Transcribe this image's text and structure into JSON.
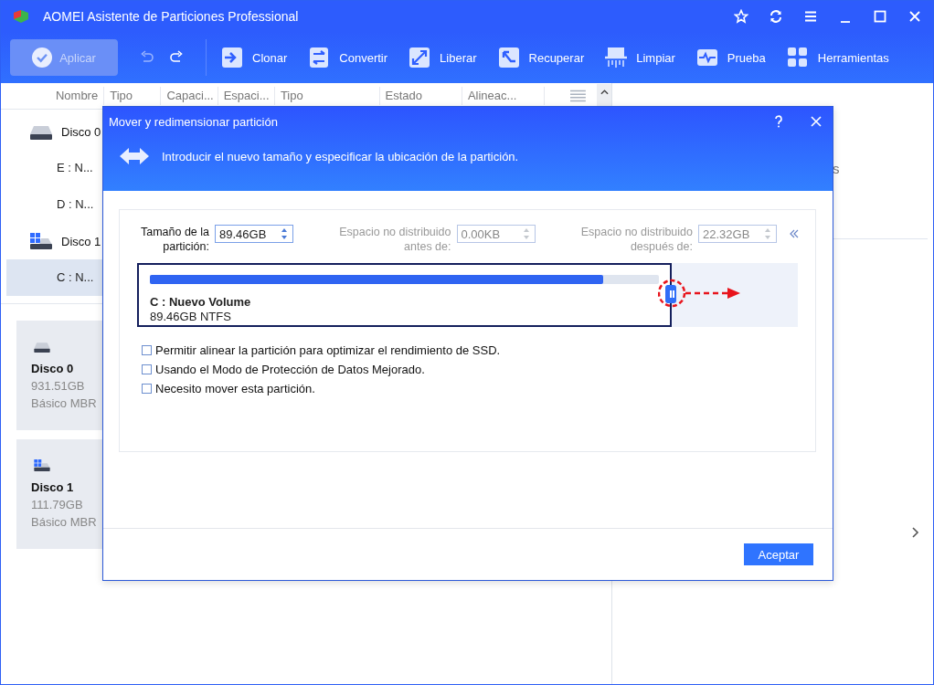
{
  "window": {
    "title": "AOMEI Asistente de Particiones Professional"
  },
  "toolbar": {
    "apply": {
      "label": "Aplicar",
      "disabled": true
    },
    "tools": [
      {
        "label": "Clonar",
        "kind": "clone"
      },
      {
        "label": "Convertir",
        "kind": "convert"
      },
      {
        "label": "Liberar",
        "kind": "free"
      },
      {
        "label": "Recuperar",
        "kind": "recover"
      },
      {
        "label": "Limpiar",
        "kind": "wipe"
      },
      {
        "label": "Prueba",
        "kind": "test"
      },
      {
        "label": "Herramientas",
        "kind": "tools"
      }
    ]
  },
  "table": {
    "columns": [
      "Nombre",
      "Tipo",
      "Capaci...",
      "Espaci...",
      "Tipo",
      "Estado",
      "Alineac..."
    ]
  },
  "tree": [
    {
      "label": "Disco 0",
      "kind": "disk",
      "children": [
        {
          "label": "E : N...",
          "selected": false
        },
        {
          "label": "D : N...",
          "selected": false
        }
      ]
    },
    {
      "label": "Disco 1",
      "kind": "system",
      "children": [
        {
          "label": "C : N...",
          "selected": true
        }
      ]
    }
  ],
  "disk_cards": [
    {
      "name": "Disco 0",
      "size": "931.51GB",
      "type": "Básico MBR",
      "kind": "disk"
    },
    {
      "name": "Disco 1",
      "size": "111.79GB",
      "type": "Básico MBR",
      "kind": "system"
    }
  ],
  "right_panel": {
    "column_1": "s"
  },
  "dialog": {
    "title": "Mover y redimensionar partición",
    "banner": "Introducir el nuevo tamaño y especificar la ubicación de la partición.",
    "fields": [
      {
        "label": "Tamaño de la partición:",
        "value": "89.46GB",
        "disabled": false
      },
      {
        "label": "Espacio no distribuido antes de:",
        "value": "0.00KB",
        "disabled": true
      },
      {
        "label": "Espacio no distribuido después de:",
        "value": "22.32GB",
        "disabled": true
      }
    ],
    "partition": {
      "name": "C : Nuevo Volume",
      "info": "89.46GB NTFS",
      "level": 0.89
    },
    "options": [
      {
        "label": "Permitir alinear la partición para optimizar el rendimiento de SSD.",
        "checked": false
      },
      {
        "label": "Usando el Modo de Protección de Datos Mejorado.",
        "checked": false
      },
      {
        "label": "Necesito mover esta partición.",
        "checked": false
      }
    ],
    "ok_button": "Aceptar"
  }
}
